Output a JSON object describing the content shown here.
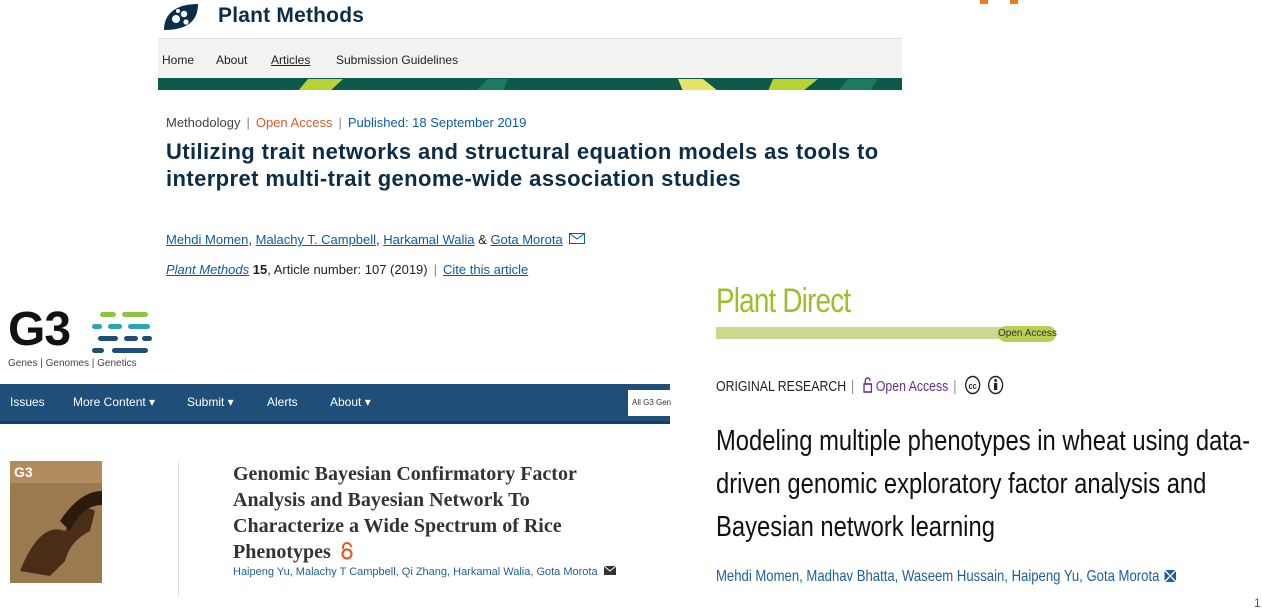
{
  "plant_methods": {
    "journal_title": "Plant Methods",
    "nav": [
      "Home",
      "About",
      "Articles",
      "Submission Guidelines"
    ],
    "article_type": "Methodology",
    "open_access": "Open Access",
    "published": "Published: 18 September 2019",
    "headline": "Utilizing trait networks and structural equation models as tools to interpret multi-trait genome-wide association studies",
    "authors": [
      "Mehdi Momen",
      "Malachy T. Campbell",
      "Harkamal Walia",
      "Gota Morota"
    ],
    "author_sep_1": ", ",
    "author_sep_2": ", ",
    "author_sep_3": " & ",
    "citation_journal": "Plant Methods",
    "citation_volume": "15",
    "citation_rest": ", Article number: 107 (2019)",
    "cite_link": "Cite this article",
    "colors": {
      "title": "#0c2d48",
      "open_access": "#e05a24",
      "published": "#0c5aa6"
    }
  },
  "g3": {
    "logo": "G3",
    "subtitle": "Genes | Genomes | Genetics",
    "nav": [
      "Issues",
      "More Content ▾",
      "Submit ▾",
      "Alerts",
      "About ▾"
    ],
    "search_placeholder": "All G3 Gen",
    "headline": "Genomic Bayesian Confirmatory Factor Analysis and Bayesian Network To Characterize a Wide Spectrum of Rice Phenotypes",
    "authors": "Haipeng Yu, Malachy T Campbell, Qi Zhang, Harkamal Walia, Gota Morota",
    "colors": {
      "nav": "#1f4e79",
      "open_access": "#e05a24"
    }
  },
  "plant_direct": {
    "logo": "Plant Direct",
    "open_access_badge": "Open Access",
    "article_type": "ORIGINAL RESEARCH",
    "open_access": "Open Access",
    "headline": "Modeling multiple phenotypes in wheat using data-driven genomic exploratory factor analysis and Bayesian network learning",
    "authors": "Mehdi Momen, Madhav Bhatta, Waseem Hussain, Haipeng Yu, Gota Morota",
    "colors": {
      "logo": "#9cbf2e",
      "open_access": "#6b2c91"
    }
  },
  "slide_number": "1"
}
